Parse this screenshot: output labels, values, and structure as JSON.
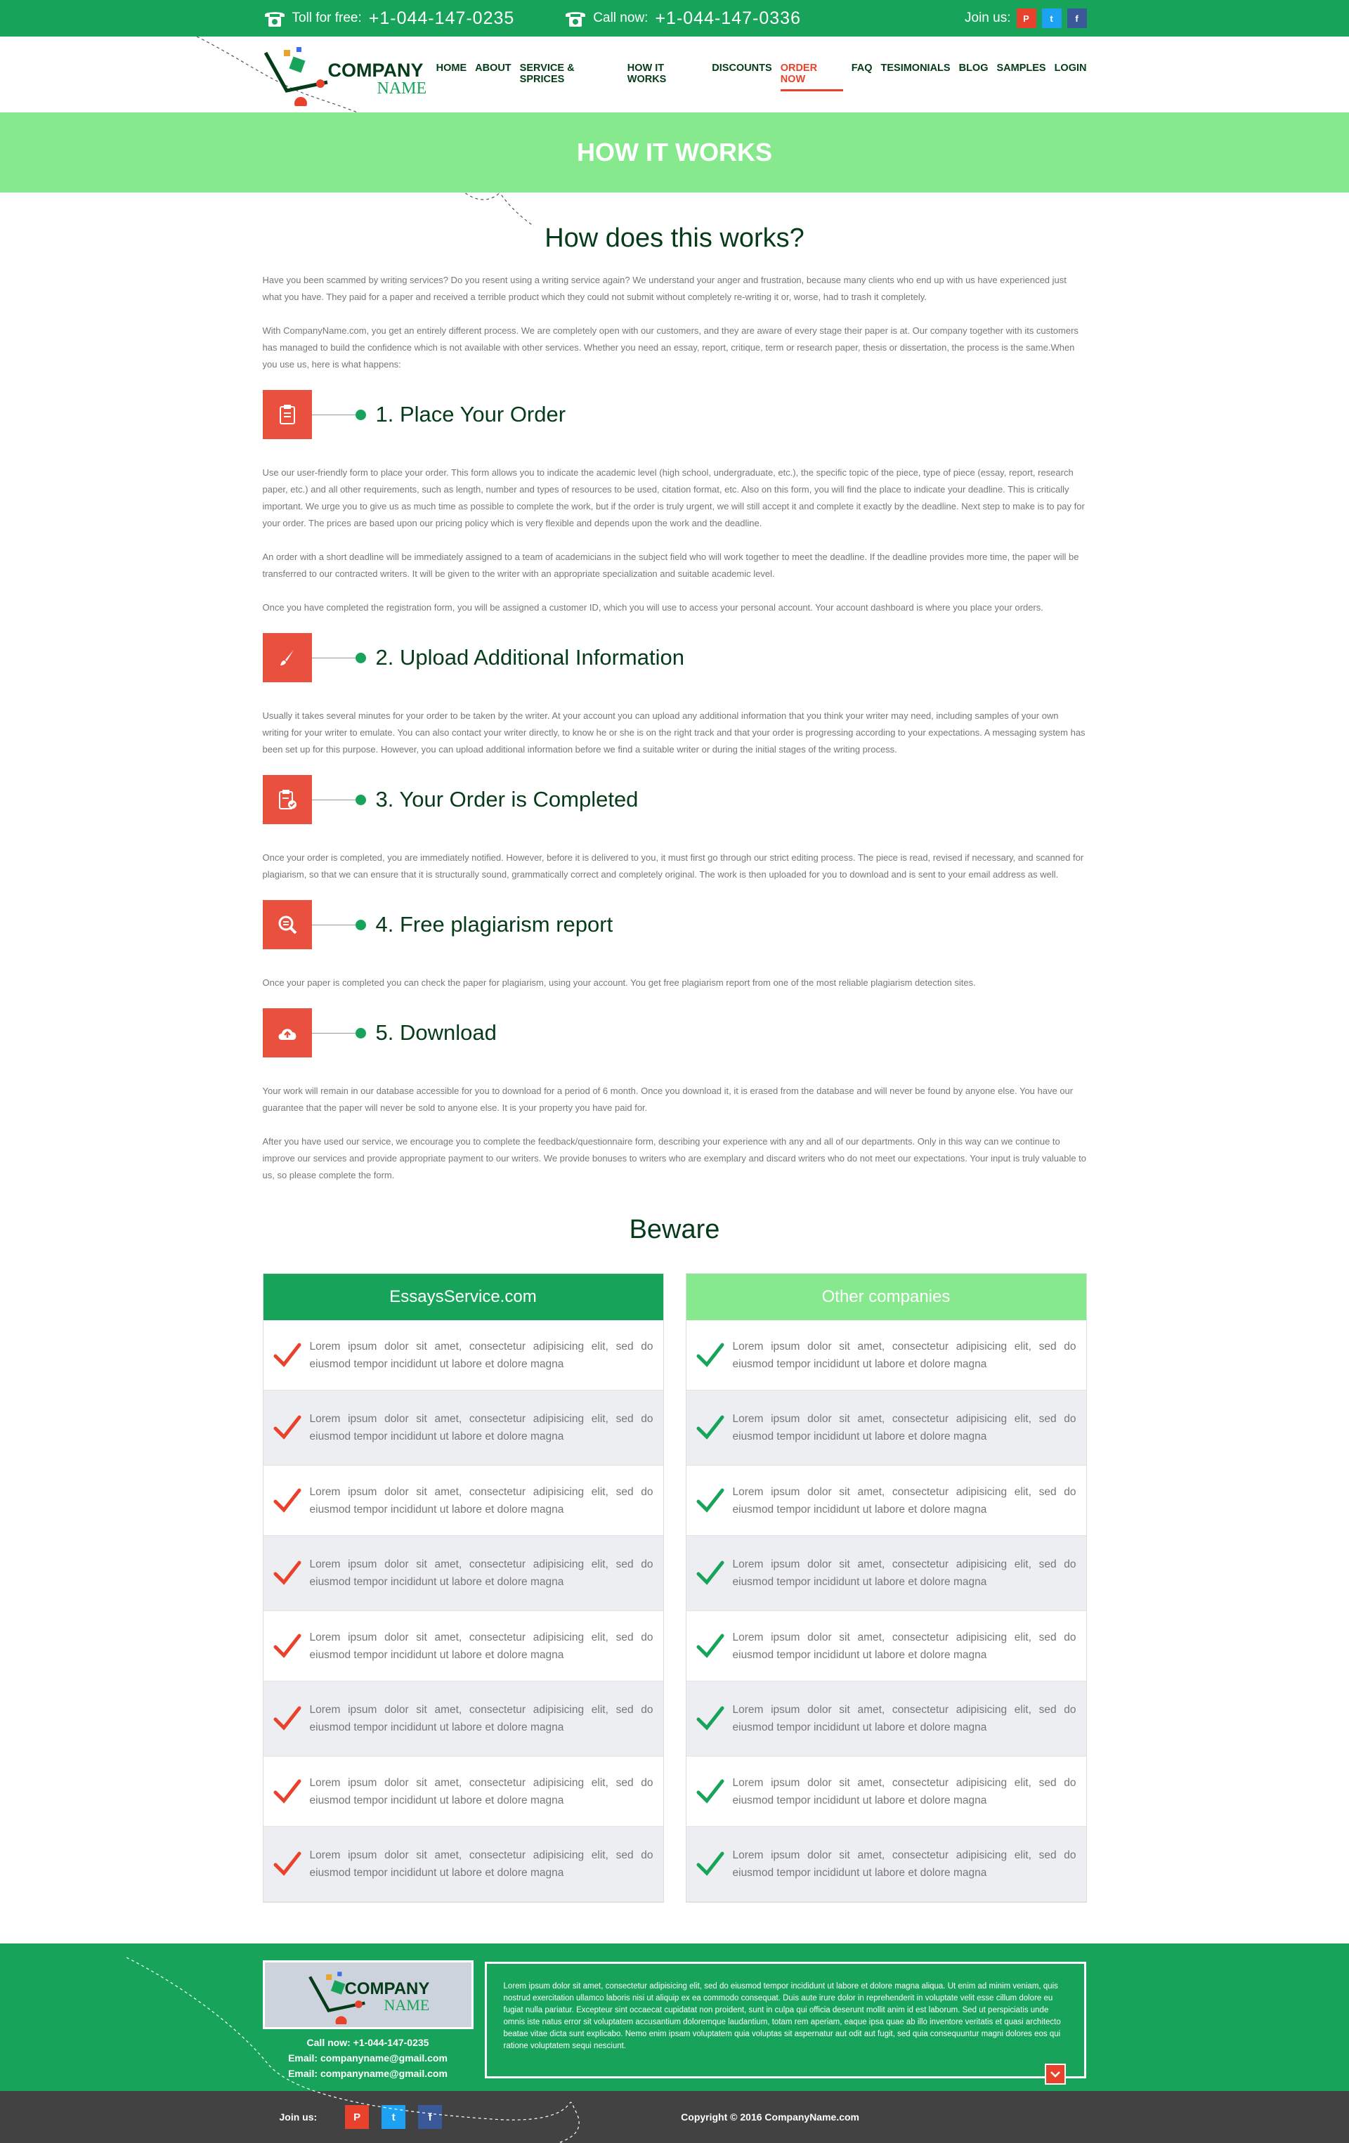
{
  "topbar": {
    "tollfree_label": "Toll for free:",
    "tollfree_number": "+1-044-147-0235",
    "callnow_label": "Call now:",
    "callnow_number": "+1-044-147-0336",
    "join_label": "Join us:",
    "social": [
      "P",
      "t",
      "f"
    ]
  },
  "logo": {
    "line1": "COMPANY",
    "line2": "NAME"
  },
  "nav": [
    "HOME",
    "ABOUT",
    "SERVICE & SPRICES",
    "HOW IT WORKS",
    "DISCOUNTS",
    "ORDER NOW",
    "FAQ",
    "TESIMONIALS",
    "BLOG",
    "SAMPLES",
    "LOGIN"
  ],
  "nav_active": "ORDER NOW",
  "hero": {
    "title": "HOW IT WORKS"
  },
  "main": {
    "heading": "How does this works?",
    "intro": [
      "Have you been scammed by writing services? Do you resent using a writing service again? We understand your anger and frustration, because many clients who end up with us have experienced just what you have.  They paid for a paper and received a terrible product which they could not submit without completely re-writing it or, worse, had to trash it completely.",
      "With CompanyName.com, you get an entirely different process.  We are completely open with our customers, and they are aware of every stage their paper is at.  Our company together with its customers has managed to build the confidence which is not available with other services.  Whether you need an essay, report, critique, term or research paper, thesis or dissertation, the process is the same.When you use us, here is what happens:"
    ],
    "steps": [
      {
        "title": "1. Place Your Order",
        "icon": "clipboard-icon",
        "paras": [
          "Use our user-friendly form to place your order.  This form allows you to indicate the academic level (high school, undergraduate, etc.), the specific topic of the piece, type of piece (essay, report, research paper, etc.) and all other requirements, such as length, number and types of resources to be used, citation format, etc.  Also on this form, you will find the place to indicate your deadline.  This is critically important.  We urge you to give us as much time as possible to complete the work, but if the order is truly urgent, we will still accept it and complete it exactly by the deadline. Next step to make is to pay for your order. The prices are based upon our pricing policy which is very flexible and depends upon the work and the deadline.",
          "An order with a short deadline will be immediately assigned to a team of academicians in the subject field who will work together to meet the deadline.  If the deadline provides more time, the paper will be transferred to our contracted writers. It will be given to the writer with an appropriate specialization and suitable academic level.",
          "Once you have completed the registration form, you will be assigned a customer ID, which you will use to access your personal account.  Your account dashboard is where you place your orders."
        ]
      },
      {
        "title": "2. Upload Additional Information",
        "icon": "brush-icon",
        "paras": [
          "Usually it takes several minutes for your order to be taken by the writer.  At your account you can upload any additional information that you think your writer may need, including samples of your own writing for your writer to emulate.  You can also contact your writer directly, to know he or she is on the right track and that your order is progressing according to your expectations.  A messaging system has been set up for this purpose. However, you can upload additional information before we find a suitable writer or during the initial stages of the writing process."
        ]
      },
      {
        "title": "3. Your Order is Completed",
        "icon": "clipboard-check-icon",
        "paras": [
          "Once your order is completed, you are immediately notified.  However, before it is delivered to you, it must first go through our strict editing process.  The piece is read, revised if necessary, and scanned for plagiarism, so that we can ensure that it is structurally sound, grammatically correct and completely original.  The work is then uploaded for you to download and is sent to your email address as well."
        ]
      },
      {
        "title": "4. Free plagiarism report",
        "icon": "search-doc-icon",
        "paras": [
          "Once your paper is completed you can check the paper for plagiarism, using your account. You get free plagiarism report from one of the most reliable plagiarism detection sites."
        ]
      },
      {
        "title": "5. Download",
        "icon": "cloud-upload-icon",
        "paras": [
          "Your work will remain in our database accessible for you to download for a period of 6 month. Once you download it, it is erased from the database and will never be found by anyone else. You have our guarantee that the paper will never be sold to anyone else. It is your property you have paid for.",
          "After you have used our service, we encourage you to complete the feedback/questionnaire form, describing your experience with any and all of our departments. Only in this way can we continue to improve our services and provide appropriate payment to our writers. We provide bonuses to writers who are exemplary and discard writers who do not meet our expectations. Your input is truly valuable to us, so please complete the form."
        ]
      }
    ],
    "beware_heading": "Beware",
    "beware": {
      "left_title": "EssaysService.com",
      "right_title": "Other companies",
      "rows": [
        "Lorem ipsum dolor sit amet, consectetur adipisicing elit, sed do eiusmod tempor incididunt ut labore et dolore magna",
        "Lorem ipsum dolor sit amet, consectetur adipisicing elit, sed do eiusmod tempor incididunt ut labore et dolore magna",
        "Lorem ipsum dolor sit amet, consectetur adipisicing elit, sed do eiusmod tempor incididunt ut labore et dolore magna",
        "Lorem ipsum dolor sit amet, consectetur adipisicing elit, sed do eiusmod tempor incididunt ut labore et dolore magna",
        "Lorem ipsum dolor sit amet, consectetur adipisicing elit, sed do eiusmod tempor incididunt ut labore et dolore magna",
        "Lorem ipsum dolor sit amet, consectetur adipisicing elit, sed do eiusmod tempor incididunt ut labore et dolore magna",
        "Lorem ipsum dolor sit amet, consectetur adipisicing elit, sed do eiusmod tempor incididunt ut labore et dolore magna",
        "Lorem ipsum dolor sit amet, consectetur adipisicing elit, sed do eiusmod tempor incididunt ut labore et dolore magna"
      ],
      "left_check_color": "#e8412c",
      "right_check_color": "#17a45a"
    }
  },
  "footer": {
    "logo_line1": "COMPANY",
    "logo_line2": "NAME",
    "contact": [
      "Call now: +1-044-147-0235",
      "Email: companyname@gmail.com",
      "Email: companyname@gmail.com"
    ],
    "text": "Lorem ipsum dolor sit amet, consectetur adipisicing elit, sed do eiusmod tempor incididunt ut labore et dolore magna aliqua. Ut enim ad minim veniam, quis nostrud exercitation ullamco laboris nisi ut aliquip ex ea commodo consequat. Duis aute irure dolor in reprehenderit in voluptate velit esse cillum dolore eu fugiat nulla pariatur. Excepteur sint occaecat cupidatat non proident, sunt in culpa qui officia deserunt mollit anim id est laborum. Sed ut perspiciatis unde omnis iste natus error sit voluptatem accusantium doloremque laudantium, totam rem aperiam, eaque ipsa quae ab illo inventore veritatis et quasi architecto beatae vitae dicta sunt explicabo. Nemo enim ipsam voluptatem quia voluptas sit aspernatur aut odit aut fugit, sed quia consequuntur magni dolores eos qui ratione voluptatem sequi nesciunt.",
    "join_label": "Join us:",
    "copyright": "Copyright © 2016 CompanyName.com"
  },
  "colors": {
    "green": "#17a45a",
    "light_green": "#86e98d",
    "red": "#e8412c",
    "dark": "#063b1a",
    "footer_bottom": "#424242"
  }
}
